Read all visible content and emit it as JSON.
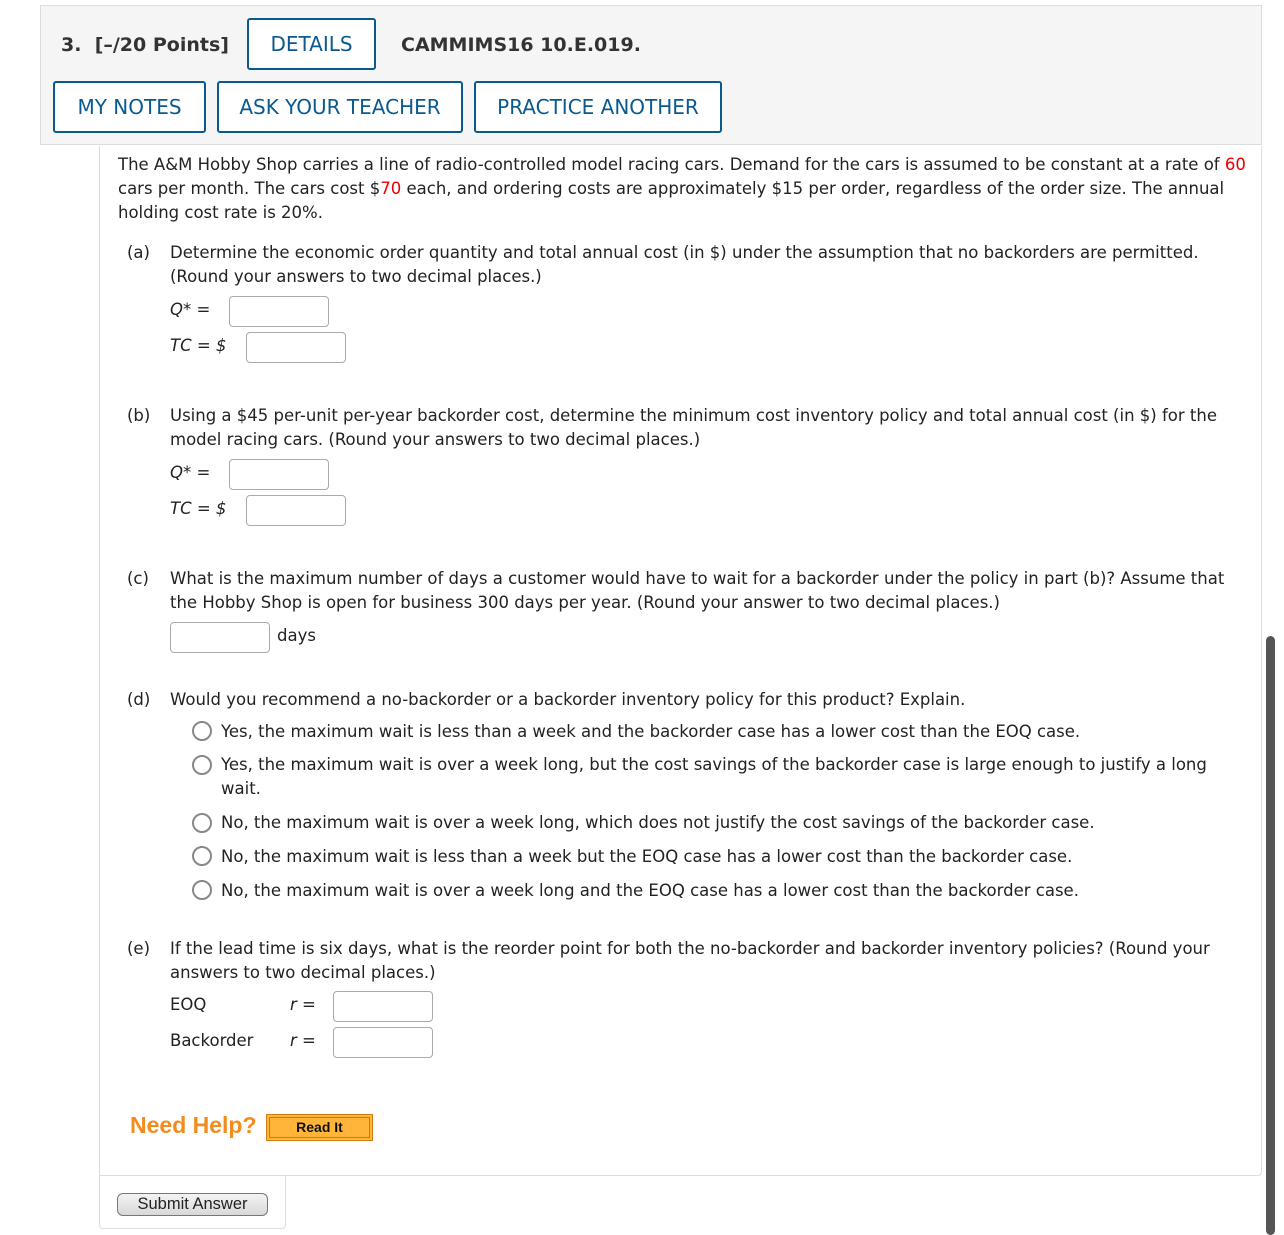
{
  "header": {
    "question_number": "3.",
    "points": "[–/20 Points]",
    "details_label": "DETAILS",
    "question_id": "CAMMIMS16 10.E.019.",
    "my_notes_label": "MY NOTES",
    "ask_teacher_label": "ASK YOUR TEACHER",
    "practice_another_label": "PRACTICE ANOTHER"
  },
  "problem": {
    "intro_1": "The A&M Hobby Shop carries a line of radio-controlled model racing cars. Demand for the cars is assumed to be constant at a rate of ",
    "rate": "60",
    "intro_2": " cars per month. The cars cost $",
    "cost": "70",
    "intro_3": " each, and ordering costs are approximately $15 per order, regardless of the order size. The annual holding cost rate is 20%."
  },
  "parts": {
    "a": {
      "letter": "(a)",
      "text": "Determine the economic order quantity and total annual cost (in $) under the assumption that no backorders are permitted. (Round your answers to two decimal places.)",
      "q_label": "Q* =",
      "tc_label": "TC = $",
      "q_value": "",
      "tc_value": ""
    },
    "b": {
      "letter": "(b)",
      "text": "Using a $45 per-unit per-year backorder cost, determine the minimum cost inventory policy and total annual cost (in $) for the model racing cars. (Round your answers to two decimal places.)",
      "q_label": "Q* =",
      "tc_label": "TC = $",
      "q_value": "",
      "tc_value": ""
    },
    "c": {
      "letter": "(c)",
      "text": "What is the maximum number of days a customer would have to wait for a backorder under the policy in part (b)? Assume that the Hobby Shop is open for business 300 days per year. (Round your answer to two decimal places.)",
      "unit": "days",
      "value": ""
    },
    "d": {
      "letter": "(d)",
      "text": "Would you recommend a no-backorder or a backorder inventory policy for this product? Explain.",
      "options": [
        "Yes, the maximum wait is less than a week and the backorder case has a lower cost than the EOQ case.",
        "Yes, the maximum wait is over a week long, but the cost savings of the backorder case is large enough to justify a long wait.",
        "No, the maximum wait is over a week long, which does not justify the cost savings of the backorder case.",
        "No, the maximum wait is less than a week but the EOQ case has a lower cost than the backorder case.",
        "No, the maximum wait is over a week long and the EOQ case has a lower cost than the backorder case."
      ]
    },
    "e": {
      "letter": "(e)",
      "text": "If the lead time is six days, what is the reorder point for both the no-backorder and backorder inventory policies? (Round your answers to two decimal places.)",
      "eoq_label": "EOQ",
      "backorder_label": "Backorder",
      "r_label": "r =",
      "eoq_value": "",
      "backorder_value": ""
    }
  },
  "help": {
    "need_help": "Need Help?",
    "read_it": "Read It"
  },
  "submit_label": "Submit Answer",
  "colors": {
    "accent": "#0a5a8f",
    "highlight": "#e00000",
    "help": "#f28c1c"
  }
}
